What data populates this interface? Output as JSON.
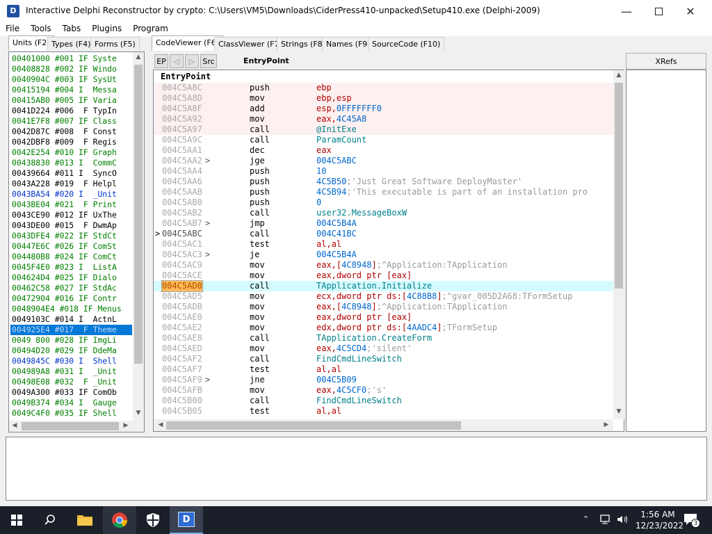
{
  "window": {
    "title": "Interactive Delphi Reconstructor by crypto: C:\\Users\\VM5\\Downloads\\CiderPress410-unpacked\\Setup410.exe (Delphi-2009)",
    "icon_glyph": "D"
  },
  "menu": [
    "File",
    "Tools",
    "Tabs",
    "Plugins",
    "Program"
  ],
  "left_tabs": [
    "Units (F2)",
    "Types (F4)",
    "Forms (F5)"
  ],
  "right_tabs": [
    "CodeViewer (F6)",
    "ClassViewer (F7)",
    "Strings (F8)",
    "Names (F9)",
    "SourceCode (F10)"
  ],
  "units": [
    {
      "text": "00401000 #001 IF Syste",
      "color": "green"
    },
    {
      "text": "00408828 #002 IF Windo",
      "color": "green"
    },
    {
      "text": "0040904C #003 IF SysUt",
      "color": "green"
    },
    {
      "text": "00415194 #004 I  Messa",
      "color": "green"
    },
    {
      "text": "00415AB0 #005 IF Varia",
      "color": "green"
    },
    {
      "text": "0041D224 #006  F TypIn",
      "color": "black"
    },
    {
      "text": "0041E7F8 #007 IF Class",
      "color": "green"
    },
    {
      "text": "0042D87C #008  F Const",
      "color": "black"
    },
    {
      "text": "0042DBF8 #009  F Regis",
      "color": "black"
    },
    {
      "text": "0042E254 #010 IF Graph",
      "color": "green"
    },
    {
      "text": "00438830 #013 I  CommC",
      "color": "green"
    },
    {
      "text": "00439664 #011 I  SyncO",
      "color": "black"
    },
    {
      "text": "0043A228 #019  F Helpl",
      "color": "black"
    },
    {
      "text": "0043BA54 #020 I  _Unit",
      "color": "blue"
    },
    {
      "text": "0043BE04 #021  F Print",
      "color": "green"
    },
    {
      "text": "0043CE90 #012 IF UxThe",
      "color": "black"
    },
    {
      "text": "0043DE00 #015  F DwmAp",
      "color": "black"
    },
    {
      "text": "0043DFE4 #022 IF StdCt",
      "color": "green"
    },
    {
      "text": "00447E6C #026 IF ComSt",
      "color": "green"
    },
    {
      "text": "004480B8 #024 IF ComCt",
      "color": "green"
    },
    {
      "text": "0045F4E0 #023 I  ListA",
      "color": "green"
    },
    {
      "text": "004624D4 #025 IF Dialo",
      "color": "green"
    },
    {
      "text": "00462C58 #027 IF StdAc",
      "color": "green"
    },
    {
      "text": "00472904 #016 IF Contr",
      "color": "green"
    },
    {
      "text": "0048904E4 #018 IF Menus",
      "color": "green"
    },
    {
      "text": "0049103C #014 I  ActnL",
      "color": "black"
    },
    {
      "text": "004925E4 #017  F Theme",
      "color": "sel"
    },
    {
      "text": "0049 800 #028 IF ImgLi",
      "color": "green"
    },
    {
      "text": "00494D20 #029 IF DdeMa",
      "color": "green"
    },
    {
      "text": "0049845C #030 I  Shell",
      "color": "blue"
    },
    {
      "text": "004989A8 #031 I  _Unit",
      "color": "green"
    },
    {
      "text": "00498E08 #032  F _Unit",
      "color": "green"
    },
    {
      "text": "0049A300 #033 IF ComOb",
      "color": "black"
    },
    {
      "text": "0049B374 #034 I  Gauge",
      "color": "green"
    },
    {
      "text": "0049C4F0 #035 IF Shell",
      "color": "green"
    }
  ],
  "toolbar": {
    "ep": "EP",
    "back": "◁",
    "forward": "▷",
    "src": "Src",
    "entry_label": "EntryPoint"
  },
  "code_header": "EntryPoint",
  "code": [
    {
      "addr": "004C5A8C",
      "op": "push",
      "bg": "pink",
      "args": [
        [
          "ebp",
          "reg"
        ]
      ]
    },
    {
      "addr": "004C5A8D",
      "op": "mov",
      "bg": "pink",
      "args": [
        [
          "ebp,esp",
          "reg"
        ]
      ]
    },
    {
      "addr": "004C5A8F",
      "op": "add",
      "bg": "pink",
      "args": [
        [
          "esp,",
          "reg"
        ],
        [
          "0FFFFFFF0",
          "num"
        ]
      ]
    },
    {
      "addr": "004C5A92",
      "op": "mov",
      "bg": "pink",
      "args": [
        [
          "eax,",
          "reg"
        ],
        [
          "4C45A8",
          "num"
        ]
      ]
    },
    {
      "addr": "004C5A97",
      "op": "call",
      "bg": "pink",
      "args": [
        [
          "@InitExe",
          "ref"
        ]
      ]
    },
    {
      "addr": "004C5A9C",
      "op": "call",
      "args": [
        [
          "ParamCount",
          "ref"
        ]
      ]
    },
    {
      "addr": "004C5AA1",
      "op": "dec",
      "args": [
        [
          "eax",
          "reg"
        ]
      ]
    },
    {
      "addr": "004C5AA2",
      "jmp": ">",
      "op": "jge",
      "args": [
        [
          "004C5ABC",
          "num"
        ]
      ]
    },
    {
      "addr": "004C5AA4",
      "op": "push",
      "args": [
        [
          "10",
          "num"
        ]
      ]
    },
    {
      "addr": "004C5AA6",
      "op": "push",
      "args": [
        [
          "4C5B50",
          "num"
        ],
        [
          ";'Just Great Software DeployMaster'",
          "cmt"
        ]
      ]
    },
    {
      "addr": "004C5AAB",
      "op": "push",
      "args": [
        [
          "4C5B94",
          "num"
        ],
        [
          ";'This executable is part of an installation pro",
          "cmt"
        ]
      ]
    },
    {
      "addr": "004C5AB0",
      "op": "push",
      "args": [
        [
          "0",
          "num"
        ]
      ]
    },
    {
      "addr": "004C5AB2",
      "op": "call",
      "args": [
        [
          "user32.MessageBoxW",
          "ref"
        ]
      ]
    },
    {
      "addr": "004C5AB7",
      "jmp": ">",
      "op": "jmp",
      "args": [
        [
          "004C5B4A",
          "num"
        ]
      ]
    },
    {
      "addr": "004C5ABC",
      "marker": ">",
      "dark": true,
      "op": "call",
      "args": [
        [
          "004C41BC",
          "num"
        ]
      ]
    },
    {
      "addr": "004C5AC1",
      "op": "test",
      "args": [
        [
          "al,al",
          "reg"
        ]
      ]
    },
    {
      "addr": "004C5AC3",
      "jmp": ">",
      "op": "je",
      "args": [
        [
          "004C5B4A",
          "num"
        ]
      ]
    },
    {
      "addr": "004C5AC9",
      "op": "mov",
      "args": [
        [
          "eax,[",
          "reg"
        ],
        [
          "4C8948",
          "num"
        ],
        [
          "]",
          "reg"
        ],
        [
          ";^Application:TApplication",
          "cmt"
        ]
      ]
    },
    {
      "addr": "004C5ACE",
      "op": "mov",
      "args": [
        [
          "eax,dword ptr [eax]",
          "reg"
        ]
      ]
    },
    {
      "addr": "004C5AD0",
      "op": "call",
      "bg": "cyan",
      "hl": true,
      "args": [
        [
          "TApplication.Initialize",
          "ref"
        ]
      ]
    },
    {
      "addr": "004C5AD5",
      "op": "mov",
      "args": [
        [
          "ecx,dword ptr ds:[",
          "reg"
        ],
        [
          "4C88B8",
          "num"
        ],
        [
          "]",
          "reg"
        ],
        [
          ";^gvar_005D2A68:TFormSetup",
          "cmt"
        ]
      ]
    },
    {
      "addr": "004C5ADB",
      "op": "mov",
      "args": [
        [
          "eax,[",
          "reg"
        ],
        [
          "4C8948",
          "num"
        ],
        [
          "]",
          "reg"
        ],
        [
          ";^Application:TApplication",
          "cmt"
        ]
      ]
    },
    {
      "addr": "004C5AE0",
      "op": "mov",
      "args": [
        [
          "eax,dword ptr [eax]",
          "reg"
        ]
      ]
    },
    {
      "addr": "004C5AE2",
      "op": "mov",
      "args": [
        [
          "edx,dword ptr ds:[",
          "reg"
        ],
        [
          "4AADC4",
          "num"
        ],
        [
          "]",
          "reg"
        ],
        [
          ";TFormSetup",
          "cmt"
        ]
      ]
    },
    {
      "addr": "004C5AE8",
      "op": "call",
      "args": [
        [
          "TApplication.CreateForm",
          "ref"
        ]
      ]
    },
    {
      "addr": "004C5AED",
      "op": "mov",
      "args": [
        [
          "eax,",
          "reg"
        ],
        [
          "4C5CD4",
          "num"
        ],
        [
          ";'silent'",
          "cmt"
        ]
      ]
    },
    {
      "addr": "004C5AF2",
      "op": "call",
      "args": [
        [
          "FindCmdLineSwitch",
          "ref"
        ]
      ]
    },
    {
      "addr": "004C5AF7",
      "op": "test",
      "args": [
        [
          "al,al",
          "reg"
        ]
      ]
    },
    {
      "addr": "004C5AF9",
      "jmp": ">",
      "op": "jne",
      "args": [
        [
          "004C5B09",
          "num"
        ]
      ]
    },
    {
      "addr": "004C5AFB",
      "op": "mov",
      "args": [
        [
          "eax,",
          "reg"
        ],
        [
          "4C5CF0",
          "num"
        ],
        [
          ";'s'",
          "cmt"
        ]
      ]
    },
    {
      "addr": "004C5B00",
      "op": "call",
      "args": [
        [
          "FindCmdLineSwitch",
          "ref"
        ]
      ]
    },
    {
      "addr": "004C5B05",
      "op": "test",
      "args": [
        [
          "al,al",
          "reg"
        ]
      ]
    }
  ],
  "xrefs_label": "XRefs",
  "clock": {
    "time": "1:56 AM",
    "date": "12/23/2022"
  },
  "notification_count": "3"
}
